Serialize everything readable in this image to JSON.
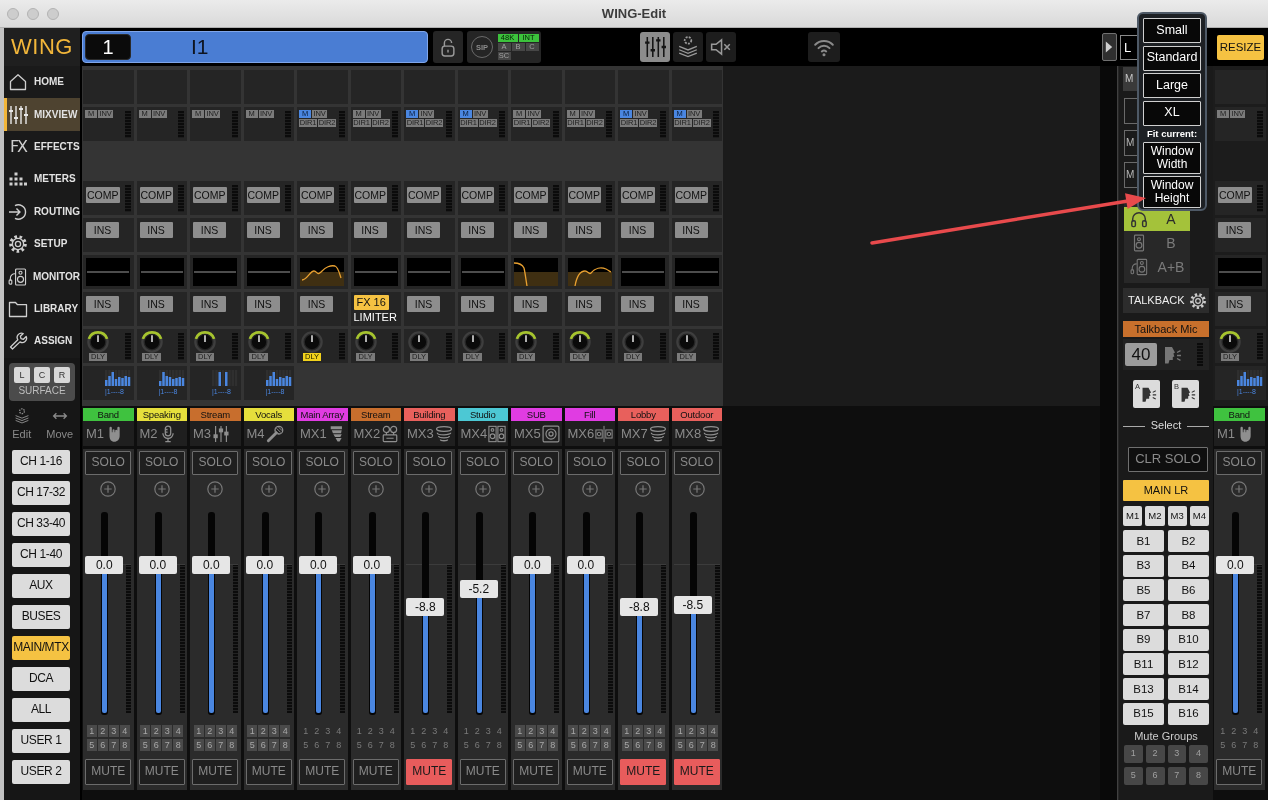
{
  "window": {
    "title": "WING-Edit"
  },
  "sidebar": {
    "logo": "WING",
    "nav": [
      {
        "label": "HOME",
        "selected": false
      },
      {
        "label": "MIXVIEW",
        "selected": true
      },
      {
        "label": "EFFECTS",
        "glyph": "FX",
        "selected": false
      },
      {
        "label": "METERS",
        "selected": false
      },
      {
        "label": "ROUTING",
        "selected": false
      },
      {
        "label": "SETUP",
        "selected": false
      },
      {
        "label": "MONITOR",
        "selected": false
      },
      {
        "label": "LIBRARY",
        "selected": false
      },
      {
        "label": "ASSIGN",
        "selected": false
      }
    ],
    "surface": {
      "label": "SURFACE",
      "buttons": [
        "L",
        "C",
        "R"
      ]
    },
    "tools": [
      "Edit",
      "Move"
    ],
    "layers": [
      {
        "label": "CH 1-16",
        "selected": false
      },
      {
        "label": "CH 17-32",
        "selected": false
      },
      {
        "label": "CH 33-40",
        "selected": false
      },
      {
        "label": "CH 1-40",
        "selected": false
      },
      {
        "label": "AUX",
        "selected": false
      },
      {
        "label": "BUSES",
        "selected": false
      },
      {
        "label": "MAIN/MTX",
        "selected": true
      },
      {
        "label": "DCA",
        "selected": false
      },
      {
        "label": "ALL",
        "selected": false
      },
      {
        "label": "USER 1",
        "selected": false
      },
      {
        "label": "USER 2",
        "selected": false
      }
    ]
  },
  "top_bar": {
    "channel_number": "1",
    "channel_name": "I1",
    "sip": "SIP",
    "sync": [
      {
        "label": "48K",
        "on": true
      },
      {
        "label": "INT",
        "on": true
      },
      {
        "label": "A",
        "on": false
      },
      {
        "label": "B",
        "on": false
      },
      {
        "label": "C",
        "on": false
      },
      {
        "label": "SC",
        "on": false
      }
    ],
    "views": [
      {
        "selected": true
      },
      {
        "selected": false
      },
      {
        "selected": false
      }
    ]
  },
  "resize": {
    "label": "RESIZE",
    "open": true,
    "sizes": [
      "Small",
      "Standard",
      "Large",
      "XL"
    ],
    "fit_label": "Fit current:",
    "fit": [
      "Window Width",
      "Window Height"
    ]
  },
  "strips": [
    {
      "id": "M1",
      "name": "Band",
      "color": "#3fc23f",
      "m": "M",
      "m_on": false,
      "inv": "INV",
      "comp": "COMP",
      "ins": "INS",
      "eq_on": false,
      "post": {
        "kind": "ins",
        "label": "INS"
      },
      "knob_on": true,
      "dly": "DLY",
      "dly_on": false,
      "sends": "|1----8",
      "solo": "SOLO",
      "fader": "0.0",
      "level": 0.74,
      "groups": [
        "1",
        "2",
        "3",
        "4",
        "5",
        "6",
        "7",
        "8"
      ],
      "groups_framed": true,
      "mute": "MUTE",
      "muted": false
    },
    {
      "id": "M2",
      "name": "Speaking",
      "color": "#e6df3c",
      "m": "M",
      "m_on": false,
      "inv": "INV",
      "comp": "COMP",
      "ins": "INS",
      "eq_on": false,
      "post": {
        "kind": "ins",
        "label": "INS"
      },
      "knob_on": true,
      "dly": "DLY",
      "dly_on": false,
      "sends": "|1----8",
      "solo": "SOLO",
      "fader": "0.0",
      "level": 0.74,
      "groups": [
        "1",
        "2",
        "3",
        "4",
        "5",
        "6",
        "7",
        "8"
      ],
      "groups_framed": true,
      "mute": "MUTE",
      "muted": false
    },
    {
      "id": "M3",
      "name": "Stream",
      "color": "#c86e2d",
      "m": "M",
      "m_on": false,
      "inv": "INV",
      "comp": "COMP",
      "ins": "INS",
      "eq_on": false,
      "post": {
        "kind": "ins",
        "label": "INS"
      },
      "knob_on": true,
      "dly": "DLY",
      "dly_on": false,
      "sends": "|1----8",
      "solo": "SOLO",
      "fader": "0.0",
      "level": 0.74,
      "groups": [
        "1",
        "2",
        "3",
        "4",
        "5",
        "6",
        "7",
        "8"
      ],
      "groups_framed": true,
      "mute": "MUTE",
      "muted": false
    },
    {
      "id": "M4",
      "name": "Vocals",
      "color": "#e6df3c",
      "m": "M",
      "m_on": false,
      "inv": "INV",
      "comp": "COMP",
      "ins": "INS",
      "eq_on": false,
      "post": {
        "kind": "ins",
        "label": "INS"
      },
      "knob_on": true,
      "dly": "DLY",
      "dly_on": false,
      "sends": "|1----8",
      "solo": "SOLO",
      "fader": "0.0",
      "level": 0.74,
      "groups": [
        "1",
        "2",
        "3",
        "4",
        "5",
        "6",
        "7",
        "8"
      ],
      "groups_framed": true,
      "mute": "MUTE",
      "muted": false
    },
    {
      "id": "MX1",
      "name": "Main Array",
      "color": "#e03ce2",
      "m": "M",
      "m_on": true,
      "inv": "INV",
      "dir": [
        "DIR1",
        "DIR2"
      ],
      "comp": "COMP",
      "ins": "INS",
      "eq_on": true,
      "post": {
        "kind": "ins",
        "label": "INS"
      },
      "knob_on": false,
      "dly": "DLY",
      "dly_on": true,
      "solo": "SOLO",
      "fader": "0.0",
      "level": 0.74,
      "groups": [
        "1",
        "2",
        "3",
        "4",
        "5",
        "6",
        "7",
        "8"
      ],
      "groups_framed": false,
      "mute": "MUTE",
      "muted": false
    },
    {
      "id": "MX2",
      "name": "Stream",
      "color": "#c86e2d",
      "m": "M",
      "m_on": false,
      "inv": "INV",
      "dir": [
        "DIR1",
        "DIR2"
      ],
      "comp": "COMP",
      "ins": "INS",
      "eq_on": false,
      "post": {
        "kind": "fx",
        "label": "FX 16",
        "name": "LIMITER"
      },
      "knob_on": true,
      "dly": "DLY",
      "dly_on": false,
      "solo": "SOLO",
      "fader": "0.0",
      "level": 0.74,
      "groups": [
        "1",
        "2",
        "3",
        "4",
        "5",
        "6",
        "7",
        "8"
      ],
      "groups_framed": false,
      "mute": "MUTE",
      "muted": false
    },
    {
      "id": "MX3",
      "name": "Building",
      "color": "#e8605c",
      "m": "M",
      "m_on": true,
      "inv": "INV",
      "dir": [
        "DIR1",
        "DIR2"
      ],
      "comp": "COMP",
      "ins": "INS",
      "eq_on": false,
      "post": {
        "kind": "ins",
        "label": "INS"
      },
      "knob_on": false,
      "dly": "DLY",
      "dly_on": false,
      "solo": "SOLO",
      "fader": "-8.8",
      "level": 0.53,
      "groups": [
        "1",
        "2",
        "3",
        "4",
        "5",
        "6",
        "7",
        "8"
      ],
      "groups_framed": false,
      "mute": "MUTE",
      "muted": true
    },
    {
      "id": "MX4",
      "name": "Studio",
      "color": "#4cc8d4",
      "m": "M",
      "m_on": true,
      "inv": "INV",
      "dir": [
        "DIR1",
        "DIR2"
      ],
      "comp": "COMP",
      "ins": "INS",
      "eq_on": false,
      "post": {
        "kind": "ins",
        "label": "INS"
      },
      "knob_on": false,
      "dly": "DLY",
      "dly_on": false,
      "solo": "SOLO",
      "fader": "-5.2",
      "level": 0.62,
      "groups": [
        "1",
        "2",
        "3",
        "4",
        "5",
        "6",
        "7",
        "8"
      ],
      "groups_framed": false,
      "mute": "MUTE",
      "muted": false
    },
    {
      "id": "MX5",
      "name": "SUB",
      "color": "#e03ce2",
      "m": "M",
      "m_on": false,
      "inv": "INV",
      "dir": [
        "DIR1",
        "DIR2"
      ],
      "comp": "COMP",
      "ins": "INS",
      "eq_on": true,
      "post": {
        "kind": "ins",
        "label": "INS"
      },
      "knob_on": true,
      "dly": "DLY",
      "dly_on": false,
      "solo": "SOLO",
      "fader": "0.0",
      "level": 0.74,
      "groups": [
        "1",
        "2",
        "3",
        "4",
        "5",
        "6",
        "7",
        "8"
      ],
      "groups_framed": true,
      "mute": "MUTE",
      "muted": false
    },
    {
      "id": "MX6",
      "name": "Fill",
      "color": "#e03ce2",
      "m": "M",
      "m_on": false,
      "inv": "INV",
      "dir": [
        "DIR1",
        "DIR2"
      ],
      "comp": "COMP",
      "ins": "INS",
      "eq_on": true,
      "post": {
        "kind": "ins",
        "label": "INS"
      },
      "knob_on": true,
      "dly": "DLY",
      "dly_on": false,
      "solo": "SOLO",
      "fader": "0.0",
      "level": 0.74,
      "groups": [
        "1",
        "2",
        "3",
        "4",
        "5",
        "6",
        "7",
        "8"
      ],
      "groups_framed": true,
      "mute": "MUTE",
      "muted": false
    },
    {
      "id": "MX7",
      "name": "Lobby",
      "color": "#e8605c",
      "m": "M",
      "m_on": true,
      "inv": "INV",
      "dir": [
        "DIR1",
        "DIR2"
      ],
      "comp": "COMP",
      "ins": "INS",
      "eq_on": false,
      "post": {
        "kind": "ins",
        "label": "INS"
      },
      "knob_on": false,
      "dly": "DLY",
      "dly_on": false,
      "solo": "SOLO",
      "fader": "-8.8",
      "level": 0.53,
      "groups": [
        "1",
        "2",
        "3",
        "4",
        "5",
        "6",
        "7",
        "8"
      ],
      "groups_framed": true,
      "mute": "MUTE",
      "muted": true
    },
    {
      "id": "MX8",
      "name": "Outdoor",
      "color": "#e8605c",
      "m": "M",
      "m_on": true,
      "inv": "INV",
      "dir": [
        "DIR1",
        "DIR2"
      ],
      "comp": "COMP",
      "ins": "INS",
      "eq_on": false,
      "post": {
        "kind": "ins",
        "label": "INS"
      },
      "knob_on": false,
      "dly": "DLY",
      "dly_on": false,
      "solo": "SOLO",
      "fader": "-8.5",
      "level": 0.54,
      "groups": [
        "1",
        "2",
        "3",
        "4",
        "5",
        "6",
        "7",
        "8"
      ],
      "groups_framed": true,
      "mute": "MUTE",
      "muted": true
    }
  ],
  "right_strip": {
    "id": "M1",
    "name": "Band",
    "color": "#3fc23f",
    "m": "M",
    "m_on": false,
    "inv": "INV",
    "comp": "COMP",
    "ins": "INS",
    "eq_on": false,
    "post": {
      "kind": "ins",
      "label": "INS"
    },
    "knob_on": true,
    "dly": "DLY",
    "dly_on": false,
    "sends": "|1----8",
    "solo": "SOLO",
    "fader": "0.0",
    "level": 0.74,
    "groups": [
      "1",
      "2",
      "3",
      "4",
      "5",
      "6",
      "7",
      "8"
    ],
    "groups_framed": false,
    "mute": "MUTE",
    "muted": false
  },
  "right_panel": {
    "layout_box": "L",
    "header": "M",
    "buttons": [
      "M",
      "M"
    ],
    "monitor": [
      {
        "label": "A",
        "selected": true
      },
      {
        "label": "B",
        "selected": false
      },
      {
        "label": "A+B",
        "selected": false
      }
    ],
    "talkback": "TALKBACK",
    "talkback_source": "Talkback Mic",
    "talkback_level": "40",
    "talk_buttons": [
      "A",
      "B"
    ],
    "select_label": "Select",
    "clear_solo": "CLR SOLO",
    "main": {
      "label": "MAIN LR",
      "selected": true
    },
    "mains": [
      {
        "label": "M1",
        "selected": false
      },
      {
        "label": "M2",
        "selected": false
      },
      {
        "label": "M3",
        "selected": false
      },
      {
        "label": "M4",
        "selected": false
      }
    ],
    "buses": [
      {
        "label": "B1",
        "selected": false
      },
      {
        "label": "B2",
        "selected": false
      },
      {
        "label": "B3",
        "selected": false
      },
      {
        "label": "B4",
        "selected": false
      },
      {
        "label": "B5",
        "selected": false
      },
      {
        "label": "B6",
        "selected": false
      },
      {
        "label": "B7",
        "selected": false
      },
      {
        "label": "B8",
        "selected": false
      },
      {
        "label": "B9",
        "selected": false
      },
      {
        "label": "B10",
        "selected": false
      },
      {
        "label": "B11",
        "selected": false
      },
      {
        "label": "B12",
        "selected": false
      },
      {
        "label": "B13",
        "selected": false
      },
      {
        "label": "B14",
        "selected": false
      },
      {
        "label": "B15",
        "selected": false
      },
      {
        "label": "B16",
        "selected": false
      }
    ],
    "mute_groups_label": "Mute Groups",
    "mute_groups": [
      {
        "label": "1",
        "on": false
      },
      {
        "label": "2",
        "on": false
      },
      {
        "label": "3",
        "on": false
      },
      {
        "label": "4",
        "on": false
      },
      {
        "label": "5",
        "on": false
      },
      {
        "label": "6",
        "on": false
      },
      {
        "label": "7",
        "on": false
      },
      {
        "label": "8",
        "on": false
      }
    ]
  }
}
